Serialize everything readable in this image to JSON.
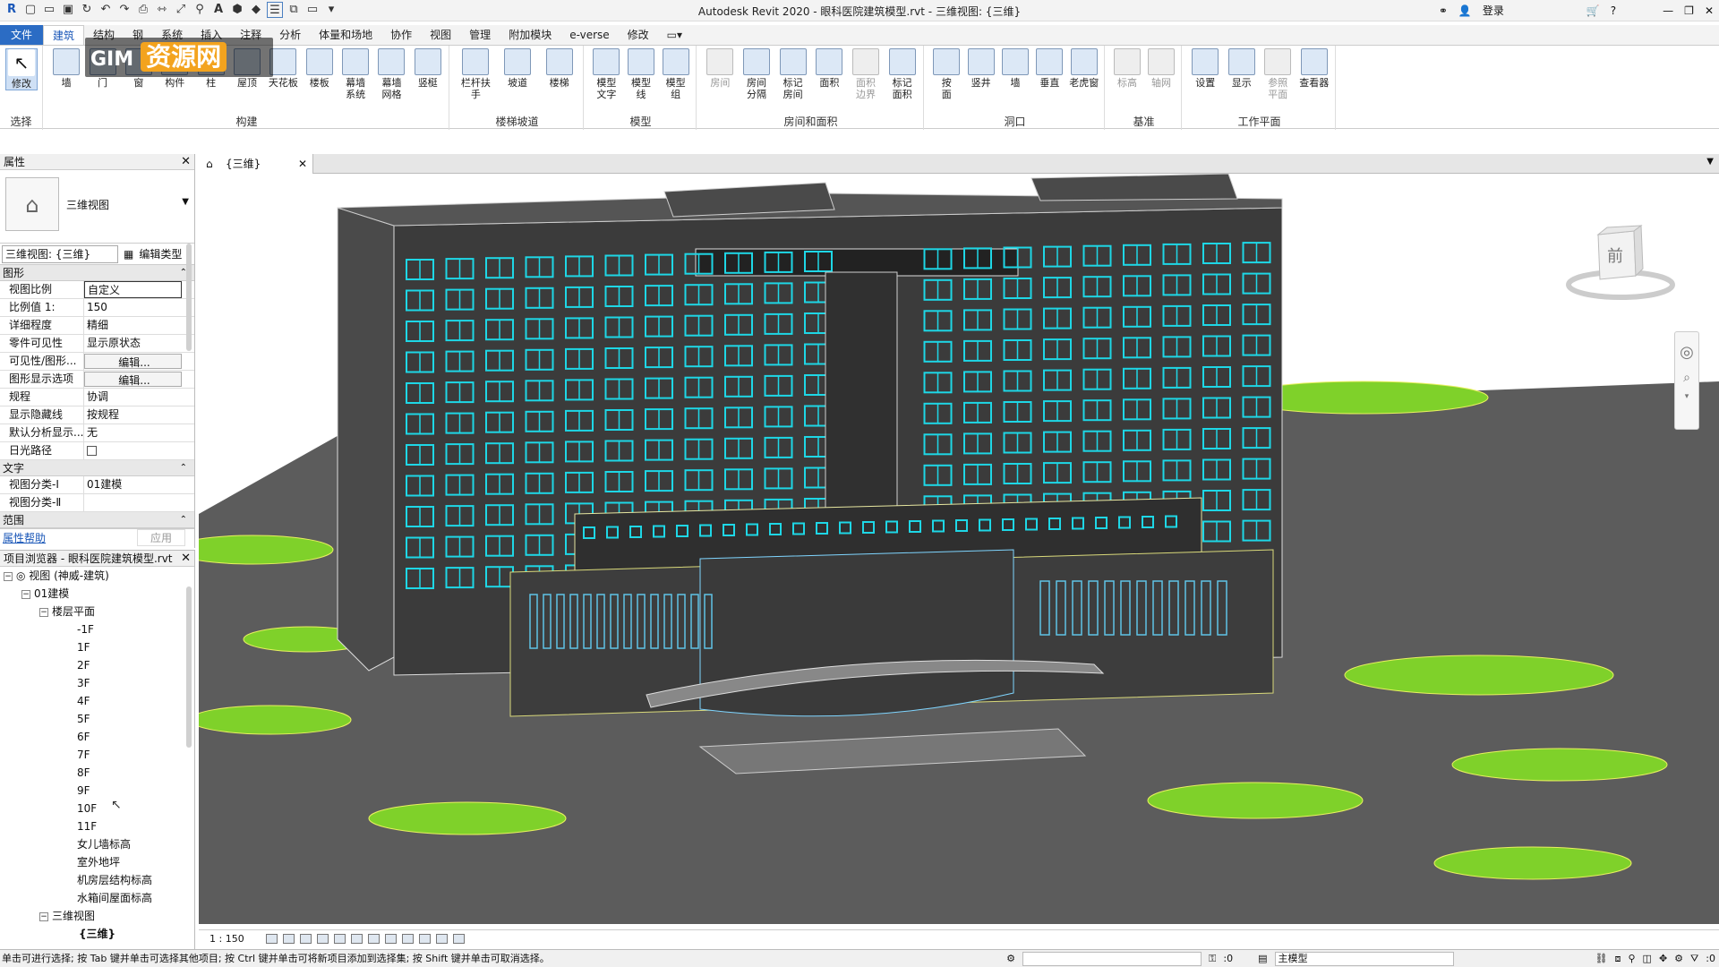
{
  "app": {
    "title": "Autodesk Revit 2020 - 眼科医院建筑模型.rvt - 三维视图: {三维}",
    "login": "登录"
  },
  "tabs": [
    "文件",
    "建筑",
    "结构",
    "钢",
    "系统",
    "插入",
    "注释",
    "分析",
    "体量和场地",
    "协作",
    "视图",
    "管理",
    "附加模块",
    "e-verse",
    "修改"
  ],
  "watermark": {
    "text": "资源网",
    "badge": "GIM"
  },
  "ribbon": {
    "select": {
      "modify": "修改",
      "group": "选择"
    },
    "build": {
      "title": "构建",
      "items": [
        "墙",
        "门",
        "窗",
        "构件",
        "柱",
        "屋顶",
        "天花板",
        "楼板",
        "幕墙\n系统",
        "幕墙\n网格",
        "竖梃"
      ]
    },
    "stairs": {
      "title": "楼梯坡道",
      "items": [
        "栏杆扶手",
        "坡道",
        "楼梯"
      ]
    },
    "model": {
      "title": "模型",
      "items": [
        "模型\n文字",
        "模型\n线",
        "模型\n组"
      ]
    },
    "room": {
      "title": "房间和面积",
      "items": [
        "房间",
        "房间\n分隔",
        "标记\n房间",
        "面积",
        "面积\n边界",
        "标记\n面积"
      ]
    },
    "opening": {
      "title": "洞口",
      "items": [
        "按\n面",
        "竖井",
        "墙",
        "垂直",
        "老虎窗"
      ]
    },
    "datum": {
      "title": "基准",
      "items": [
        "标高",
        "轴网"
      ]
    },
    "workplane": {
      "title": "工作平面",
      "items": [
        "设置",
        "显示",
        "参照\n平面",
        "查看器"
      ]
    }
  },
  "properties": {
    "header": "属性",
    "type_name": "三维视图",
    "instance": "三维视图: {三维}",
    "edit_type": "编辑类型",
    "sections": {
      "graphics": "图形",
      "text": "文字",
      "extents": "范围"
    },
    "rows": [
      {
        "k": "视图比例",
        "v": "自定义"
      },
      {
        "k": "比例值 1:",
        "v": "150"
      },
      {
        "k": "详细程度",
        "v": "精细"
      },
      {
        "k": "零件可见性",
        "v": "显示原状态"
      },
      {
        "k": "可见性/图形...",
        "v": "编辑..."
      },
      {
        "k": "图形显示选项",
        "v": "编辑..."
      },
      {
        "k": "规程",
        "v": "协调"
      },
      {
        "k": "显示隐藏线",
        "v": "按规程"
      },
      {
        "k": "默认分析显示...",
        "v": "无"
      },
      {
        "k": "日光路径",
        "v": ""
      }
    ],
    "text_rows": [
      {
        "k": "视图分类-Ⅰ",
        "v": "01建模"
      },
      {
        "k": "视图分类-Ⅱ",
        "v": ""
      }
    ],
    "help": "属性帮助",
    "apply": "应用"
  },
  "browser": {
    "header": "项目浏览器 - 眼科医院建筑模型.rvt",
    "root": "视图 (神威-建筑)",
    "group": "01建模",
    "floor_plans": "楼层平面",
    "levels": [
      "-1F",
      "1F",
      "2F",
      "3F",
      "4F",
      "5F",
      "6F",
      "7F",
      "8F",
      "9F",
      "10F",
      "11F",
      "女儿墙标高",
      "室外地坪",
      "机房层结构标高",
      "水箱间屋面标高"
    ],
    "views3d": "三维视图",
    "view3d_item": "{三维}"
  },
  "view": {
    "tab": "{三维}",
    "cube_face": "前",
    "scale": "1 : 150"
  },
  "status": {
    "hint": "单击可进行选择; 按 Tab 键并单击可选择其他项目; 按 Ctrl 键并单击可将新项目添加到选择集; 按 Shift 键并单击可取消选择。",
    "zero": ":0",
    "model": "主模型",
    "filter": ":0"
  },
  "colors": {
    "accent": "#2b6cc4",
    "ground": "#5c5c5c",
    "glass": "#1ed7e6",
    "lawn": "#7fd12a",
    "building": "#3b3b3b"
  }
}
